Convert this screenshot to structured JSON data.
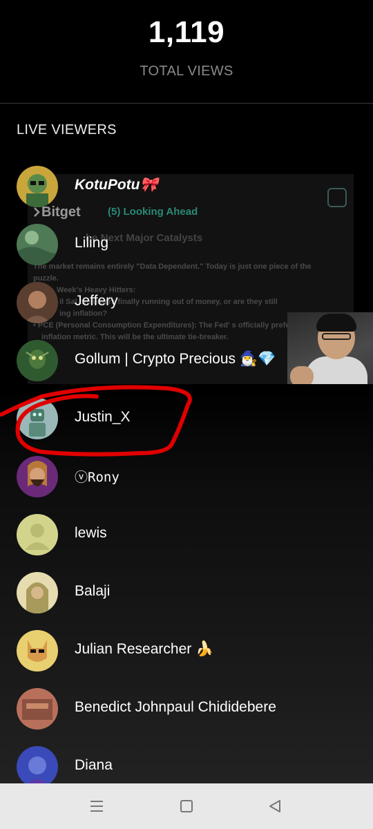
{
  "stats": {
    "total_views": "1,119",
    "total_views_label": "TOTAL VIEWS"
  },
  "live_viewers": {
    "title": "LIVE VIEWERS",
    "viewers": [
      {
        "name": "KotuPotu🎀",
        "avatar": "cartoon-avatar"
      },
      {
        "name": "Liling",
        "avatar": "landscape-avatar"
      },
      {
        "name": "Jeffery",
        "avatar": "portrait-avatar"
      },
      {
        "name": "Gollum | Crypto Precious 🧙‍♂️💎",
        "avatar": "gollum-avatar"
      },
      {
        "name": "Justin_X",
        "avatar": "robot-avatar"
      },
      {
        "name": "ⓥRony",
        "avatar": "bearded-avatar"
      },
      {
        "name": "lewis",
        "avatar": "default-avatar"
      },
      {
        "name": "Balaji",
        "avatar": "hooded-avatar"
      },
      {
        "name": "Julian Researcher 🍌",
        "avatar": "fox-avatar"
      },
      {
        "name": "Benedict Johnpaul Chididebere",
        "avatar": "photo-avatar"
      },
      {
        "name": "Diana",
        "avatar": "blue-portrait-avatar"
      }
    ]
  },
  "stream_overlay": {
    "brand": "Bitget",
    "heading": "(5) Looking Ahead",
    "subhead": "he Next Major Catalysts",
    "lines": [
      "The market remains entirely \"Data Dependent.\" Today is just one piece of the",
      "puzzle.",
      "Week's Heavy Hitters:",
      "il Sal  onsumers finally running out of money, or are they still",
      "ing inflation?",
      "• PCE (Personal Consumption Expenditures): The Fed' s officially preferred",
      "inflation metric. This will be the ultimate tie-breaker."
    ]
  },
  "navbar": {
    "icons": [
      "menu-icon",
      "home-square-icon",
      "back-triangle-icon"
    ]
  },
  "colors": {
    "background": "#000000",
    "muted_text": "#8a8a8a",
    "annotation": "#e00000",
    "navbar": "#e8e8e8"
  }
}
